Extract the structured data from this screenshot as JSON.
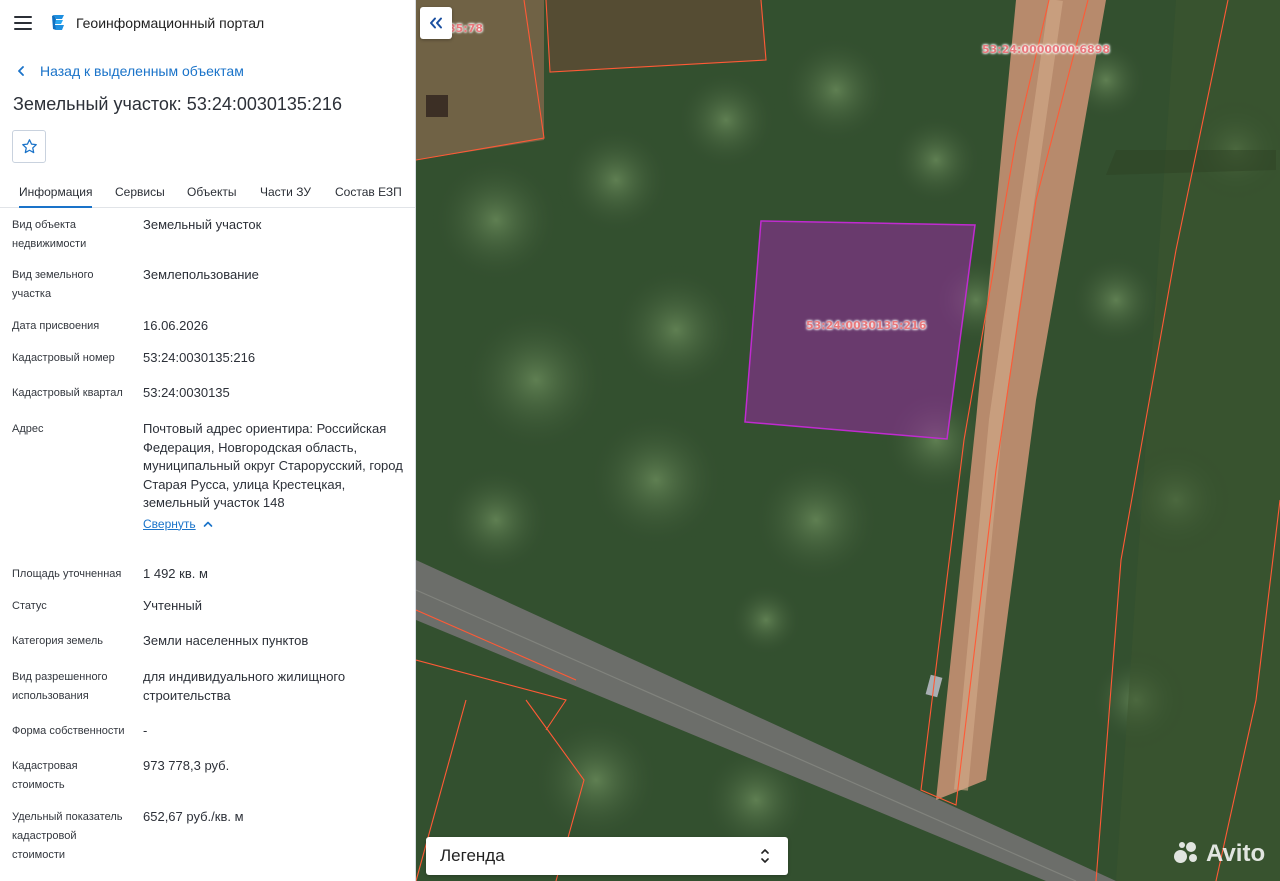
{
  "header": {
    "app_title": "Геоинформационный портал"
  },
  "nav": {
    "back_label": "Назад к выделенным объектам"
  },
  "object": {
    "title": "Земельный участок: 53:24:0030135:216"
  },
  "tabs": [
    "Информация",
    "Сервисы",
    "Объекты",
    "Части ЗУ",
    "Состав ЕЗП"
  ],
  "info": {
    "rows": [
      {
        "label": "Вид объекта недвижимости",
        "value": "Земельный участок"
      },
      {
        "label": "Вид земельного участка",
        "value": "Землепользование"
      },
      {
        "label": "Дата присвоения",
        "value": "16.06.2026"
      },
      {
        "label": "Кадастровый номер",
        "value": "53:24:0030135:216"
      },
      {
        "label": "Кадастровый квартал",
        "value": "53:24:0030135"
      },
      {
        "label": "Адрес",
        "value": "Почтовый адрес ориентира: Российская Федерация, Новгородская область, муниципальный округ Старорусский, город Старая Русса, улица Крестецкая, земельный участок 148"
      },
      {
        "label": "Площадь уточненная",
        "value": "1 492 кв. м"
      },
      {
        "label": "Статус",
        "value": "Учтенный"
      },
      {
        "label": "Категория земель",
        "value": "Земли населенных пунктов"
      },
      {
        "label": "Вид разрешенного использования",
        "value": "для индивидуального жилищного строительства"
      },
      {
        "label": "Форма собственности",
        "value": "-"
      },
      {
        "label": "Кадастровая стоимость",
        "value": "973 778,3 руб."
      },
      {
        "label": "Удельный показатель кадастровой стоимости",
        "value": "652,67 руб./кв. м"
      }
    ],
    "collapse_label": "Свернуть"
  },
  "map": {
    "labels": {
      "top_left": "35:78",
      "top_right": "53:24:0000000:6898",
      "selected": "53:24:0030135:216"
    },
    "selected_color": "#c02bd0",
    "boundary_color": "#ff5a36"
  },
  "legend": {
    "label": "Легенда"
  },
  "watermark": "Avito"
}
